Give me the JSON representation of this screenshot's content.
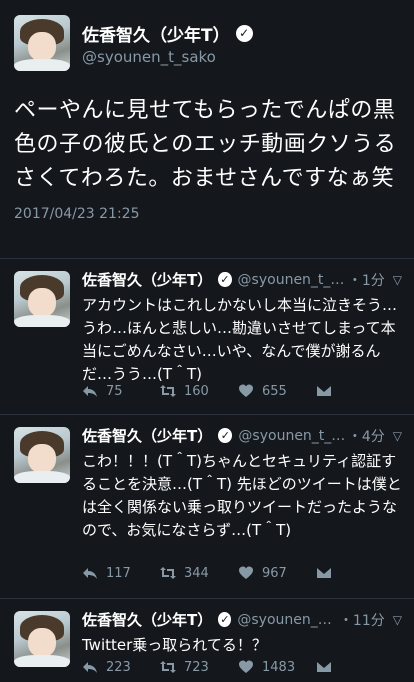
{
  "main_tweet": {
    "display_name": "佐香智久（少年T）",
    "handle": "@syounen_t_sako",
    "text": "ペーやんに見せてもらったでんぱの黒色の子の彼氏とのエッチ動画クソうるさくてわろた。おませさんですなぁ笑",
    "timestamp": "2017/04/23 21:25"
  },
  "replies": [
    {
      "display_name": "佐香智久（少年T）",
      "handle": "@syounen_t_sa...",
      "time": "・1分",
      "text": "アカウントはこれしかないし本当に泣きそう…うわ…ほんと悲しい…勘違いさせてしまって本当にごめんなさい…いや、なんで僕が謝るんだ…うう…(T＾T)",
      "replies": "75",
      "retweets": "160",
      "likes": "655"
    },
    {
      "display_name": "佐香智久（少年T）",
      "handle": "@syounen_t_s...",
      "time": "・4分",
      "text": "こわ！！！(T＾T)ちゃんとセキュリティ認証することを決意…(T＾T) 先ほどのツイートは僕とは全く関係ない乗っ取りツイートだったようなので、お気になさらず…(T＾T)",
      "replies": "117",
      "retweets": "344",
      "likes": "967"
    },
    {
      "display_name": "佐香智久（少年T）",
      "handle": "@syounen_t_s...",
      "time": "・11分",
      "text": "Twitter乗っ取られてる！？",
      "replies": "223",
      "retweets": "723",
      "likes": "1483"
    }
  ],
  "icons": {
    "verified": "verified-badge-icon",
    "reply": "reply-icon",
    "retweet": "retweet-icon",
    "like": "heart-icon",
    "dm": "envelope-icon",
    "more": "chevron-down-icon"
  },
  "colors": {
    "background": "#14171c",
    "secondary_text": "#8899a6",
    "divider": "#2a323b"
  }
}
